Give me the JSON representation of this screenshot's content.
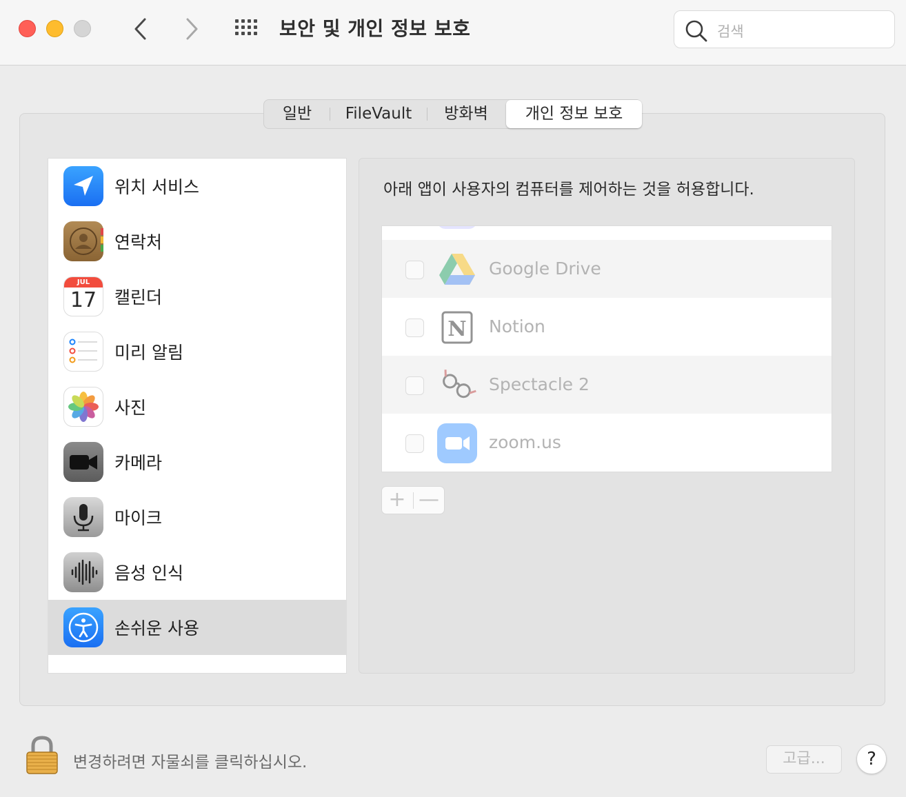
{
  "window": {
    "title": "보안 및 개인 정보 보호",
    "search_placeholder": "검색"
  },
  "tabs": [
    {
      "label": "일반"
    },
    {
      "label": "FileVault"
    },
    {
      "label": "방화벽"
    },
    {
      "label": "개인 정보 보호",
      "selected": true
    }
  ],
  "sidebar": {
    "items": [
      {
        "label": "위치 서비스",
        "icon": "location-arrow-icon"
      },
      {
        "label": "연락처",
        "icon": "contacts-icon"
      },
      {
        "label": "캘린더",
        "icon": "calendar-icon",
        "calendar_month": "JUL",
        "calendar_day": "17"
      },
      {
        "label": "미리 알림",
        "icon": "reminders-icon"
      },
      {
        "label": "사진",
        "icon": "photos-icon"
      },
      {
        "label": "카메라",
        "icon": "camera-icon"
      },
      {
        "label": "마이크",
        "icon": "microphone-icon"
      },
      {
        "label": "음성 인식",
        "icon": "speech-recognition-icon"
      },
      {
        "label": "손쉬운 사용",
        "icon": "accessibility-icon",
        "selected": true
      }
    ]
  },
  "content": {
    "description": "아래 앱이 사용자의 컴퓨터를 제어하는 것을 허용합니다.",
    "apps": [
      {
        "name": "Google Drive",
        "icon": "google-drive-icon",
        "checked": false
      },
      {
        "name": "Notion",
        "icon": "notion-icon",
        "checked": false
      },
      {
        "name": "Spectacle 2",
        "icon": "spectacle-icon",
        "checked": false
      },
      {
        "name": "zoom.us",
        "icon": "zoom-icon",
        "checked": false
      }
    ],
    "add_label": "+",
    "remove_label": "—"
  },
  "footer": {
    "lock_text": "변경하려면 자물쇠를 클릭하십시오.",
    "advanced_label": "고급...",
    "help_label": "?"
  },
  "colors": {
    "close": "#ff5f57",
    "minimize": "#febc2e",
    "zoom": "#d5d5d5",
    "accent_blue": "#1a82fb",
    "selection": "#dcdcdc"
  }
}
